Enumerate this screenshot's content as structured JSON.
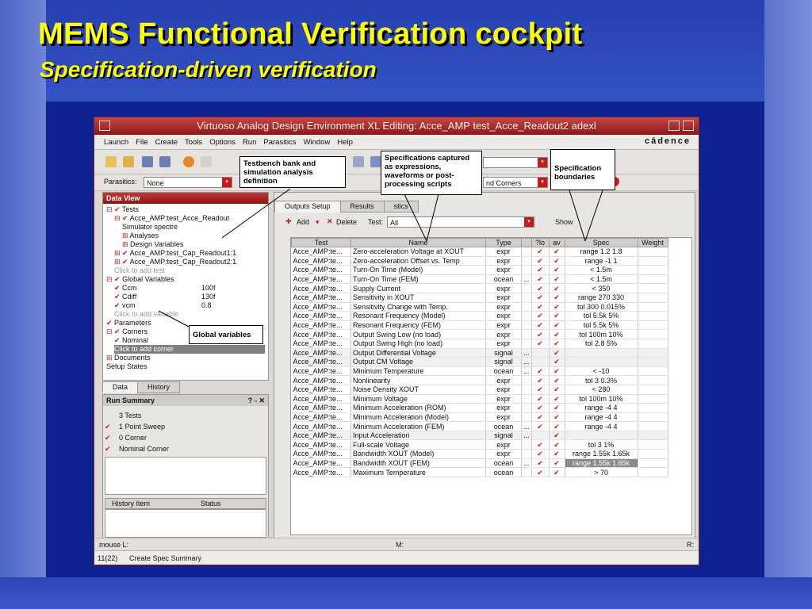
{
  "slide": {
    "title": "MEMS Functional Verification cockpit",
    "subtitle": "Specification-driven verification"
  },
  "window": {
    "title": "Virtuoso Analog Design Environment XL Editing: Acce_AMP test_Acce_Readout2 adexl",
    "brand": "cādence"
  },
  "menu": [
    "Launch",
    "File",
    "Create",
    "Tools",
    "Options",
    "Run",
    "Parasitics",
    "Window",
    "Help"
  ],
  "params": {
    "parasitics_label": "Parasitics:",
    "parasitics_value": "None",
    "corners_value": "nd Corners"
  },
  "dataview": {
    "title": "Data View",
    "rows": [
      {
        "indent": 0,
        "mark": "⊟ ✔",
        "text": "Tests"
      },
      {
        "indent": 1,
        "mark": "⊟ ✔",
        "text": "Acce_AMP:test_Acce_Readout"
      },
      {
        "indent": 2,
        "mark": "",
        "text": "Simulator  spectre"
      },
      {
        "indent": 2,
        "mark": "⊞",
        "text": "Analyses"
      },
      {
        "indent": 2,
        "mark": "⊞",
        "text": "Design Variables"
      },
      {
        "indent": 1,
        "mark": "⊞ ✔",
        "text": "Acce_AMP:test_Cap_Readout1:1"
      },
      {
        "indent": 1,
        "mark": "⊞ ✔",
        "text": "Acce_AMP:test_Cap_Readout2:1"
      },
      {
        "indent": 1,
        "mark": "",
        "text": "Click to add test",
        "gray": true
      },
      {
        "indent": 0,
        "mark": "⊟ ✔",
        "text": "Global Variables"
      },
      {
        "indent": 1,
        "mark": "✔",
        "text": "Ccm",
        "val": "100f"
      },
      {
        "indent": 1,
        "mark": "✔",
        "text": "Cdiff",
        "val": "130f"
      },
      {
        "indent": 1,
        "mark": "✔",
        "text": "vcm",
        "val": "0.8"
      },
      {
        "indent": 1,
        "mark": "",
        "text": "Click to add variable",
        "gray": true
      },
      {
        "indent": 0,
        "mark": "✔",
        "text": "Parameters"
      },
      {
        "indent": 0,
        "mark": "⊟ ✔",
        "text": "Corners"
      },
      {
        "indent": 1,
        "mark": "✔",
        "text": "Nominal"
      },
      {
        "indent": 1,
        "mark": "",
        "text": "Click to add corner",
        "sel": true
      },
      {
        "indent": 0,
        "mark": "⊞",
        "text": "Documents"
      },
      {
        "indent": 0,
        "mark": "",
        "text": "Setup States"
      }
    ]
  },
  "lefttabs": [
    "Data",
    "History"
  ],
  "runsummary": {
    "title": "Run Summary",
    "items": [
      {
        "mark": "",
        "text": "3 Tests"
      },
      {
        "mark": "✔",
        "text": "1 Point Sweep"
      },
      {
        "mark": "✔",
        "text": "0 Corner"
      },
      {
        "mark": "✔",
        "text": "Nominal Corner"
      }
    ],
    "hist_cols": [
      "History Item",
      "Status"
    ]
  },
  "righttabs": [
    "Outputs Setup",
    "Results",
    "stics"
  ],
  "specbar": {
    "add": "Add",
    "delete": "Delete",
    "test_label": "Test:",
    "test_value": "All",
    "show": "Show"
  },
  "columns": [
    "Test",
    "Name",
    "Type",
    "",
    "?lo",
    "av",
    "Spec",
    "Weight"
  ],
  "rows": [
    [
      "Acce_AMP:te...",
      "Zero-acceleration Voltage at XOUT",
      "expr",
      "",
      "✔",
      "✔",
      "range 1.2 1.8"
    ],
    [
      "Acce_AMP:te...",
      "Zero-acceleration Offset vs. Temp",
      "expr",
      "",
      "✔",
      "✔",
      "range -1 1"
    ],
    [
      "Acce_AMP:te...",
      "Turn-On Time (Model)",
      "expr",
      "",
      "✔",
      "✔",
      "< 1.5m"
    ],
    [
      "Acce_AMP:te...",
      "Turn-On Time (FEM)",
      "ocean",
      "...",
      "✔",
      "✔",
      "< 1.5m"
    ],
    [
      "Acce_AMP:te...",
      "Supply Current",
      "expr",
      "",
      "✔",
      "✔",
      "< 350"
    ],
    [
      "Acce_AMP:te...",
      "Sensitivity in XOUT",
      "expr",
      "",
      "✔",
      "✔",
      "range 270 330"
    ],
    [
      "Acce_AMP:te...",
      "Sensitivity Change with Temp.",
      "expr",
      "",
      "✔",
      "✔",
      "tol 300 0.015%"
    ],
    [
      "Acce_AMP:te...",
      "Resonant Frequency (Model)",
      "expr",
      "",
      "✔",
      "✔",
      "tol 5.5k 5%"
    ],
    [
      "Acce_AMP:te...",
      "Resonant Frequency (FEM)",
      "expr",
      "",
      "✔",
      "✔",
      "tol 5.5k 5%"
    ],
    [
      "Acce_AMP:te...",
      "Output Swing Low (no load)",
      "expr",
      "",
      "✔",
      "✔",
      "tol 100m 10%"
    ],
    [
      "Acce_AMP:te...",
      "Output Swing High (no load)",
      "expr",
      "",
      "✔",
      "✔",
      "tol 2.8 5%"
    ],
    [
      "Acce_AMP:te...",
      "Output Differential Voltage",
      "signal",
      "...",
      "",
      "✔",
      ""
    ],
    [
      "Acce_AMP:te...",
      "Output CM Voltage",
      "signal",
      "...",
      "",
      "✔",
      ""
    ],
    [
      "Acce_AMP:te...",
      "Minimum Temperature",
      "ocean",
      "...",
      "✔",
      "✔",
      "< -10"
    ],
    [
      "Acce_AMP:te...",
      "Nonlinearity",
      "expr",
      "",
      "✔",
      "✔",
      "tol 3 0.3%"
    ],
    [
      "Acce_AMP:te...",
      "Noise Density XOUT",
      "expr",
      "",
      "✔",
      "✔",
      "< 280"
    ],
    [
      "Acce_AMP:te...",
      "Minimum Voltage",
      "expr",
      "",
      "✔",
      "✔",
      "tol 100m 10%"
    ],
    [
      "Acce_AMP:te...",
      "Minimum Acceleration (ROM)",
      "expr",
      "",
      "✔",
      "✔",
      "range -4 4"
    ],
    [
      "Acce_AMP:te...",
      "Minimum Acceleration (Model)",
      "expr",
      "",
      "✔",
      "✔",
      "range -4 4"
    ],
    [
      "Acce_AMP:te...",
      "Minimum Acceleration (FEM)",
      "ocean",
      "...",
      "✔",
      "✔",
      "range -4 4"
    ],
    [
      "Acce_AMP:te...",
      "Input Acceleration",
      "signal",
      "...",
      "",
      "✔",
      ""
    ],
    [
      "Acce_AMP:te...",
      "Full-scale Voltage",
      "expr",
      "",
      "✔",
      "✔",
      "tol 3 1%"
    ],
    [
      "Acce_AMP:te...",
      "Bandwidth XOUT (Model)",
      "expr",
      "",
      "✔",
      "✔",
      "range 1.55k 1.65k"
    ],
    [
      "Acce_AMP:te...",
      "Bandwidth XOUT (FEM)",
      "ocean",
      "...",
      "✔",
      "✔",
      "range 1.55k 1.65k"
    ],
    [
      "Acce_AMP:te...",
      "Maximum Temperature",
      "ocean",
      "",
      "✔",
      "✔",
      "> 70"
    ]
  ],
  "status": {
    "left": "mouse L:",
    "mid": "M:",
    "right": "R:",
    "counter": "11(22)",
    "message": "Create Spec Summary"
  },
  "callouts": {
    "testbench": "Testbench bank and simulation analysis definition",
    "specs": "Specifications captured as expressions, waveforms or post-processing scripts",
    "boundaries": "Specification boundaries",
    "globals": "Global variables"
  },
  "colors": {
    "title": "#ffff00",
    "check": "#c21c1c",
    "window_title": "#a52525"
  }
}
